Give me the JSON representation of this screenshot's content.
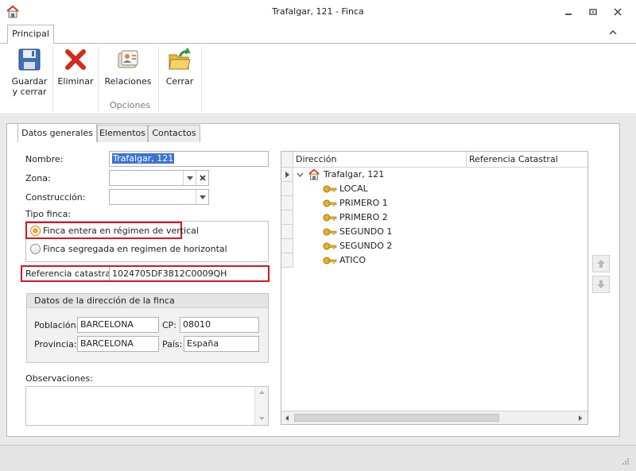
{
  "window": {
    "title": "Trafalgar, 121 - Finca"
  },
  "ribbon": {
    "tab": "Principal",
    "buttons": {
      "guardar": "Guardar\ny cerrar",
      "eliminar": "Eliminar",
      "relaciones": "Relaciones",
      "cerrar": "Cerrar"
    },
    "group_label": "Opciones"
  },
  "tabs": [
    "Datos generales",
    "Elementos",
    "Contactos"
  ],
  "form": {
    "nombre_label": "Nombre:",
    "nombre_value": "Trafalgar, 121",
    "zona_label": "Zona:",
    "zona_value": "",
    "construccion_label": "Construcción:",
    "construccion_value": "",
    "tipo_label": "Tipo finca:",
    "radio_vertical": "Finca entera en régimen de vertical",
    "radio_horizontal": "Finca segregada en regimen de horizontal",
    "radio_selected": "vertical",
    "referencia_label": "Referencia catastral:",
    "referencia_value": "1024705DF3812C0009QH",
    "direccion_group": "Datos de la dirección de la finca",
    "poblacion_label": "Población:",
    "poblacion_value": "BARCELONA",
    "cp_label": "CP:",
    "cp_value": "08010",
    "provincia_label": "Provincia:",
    "provincia_value": "BARCELONA",
    "pais_label": "País:",
    "pais_value": "España",
    "observaciones_label": "Observaciones:",
    "observaciones_value": ""
  },
  "grid": {
    "columns": [
      "Dirección",
      "Referencia Catastral"
    ],
    "root": "Trafalgar, 121",
    "children": [
      "LOCAL",
      "PRIMERO 1",
      "PRIMERO 2",
      "SEGUNDO 1",
      "SEGUNDO 2",
      "ATICO"
    ]
  },
  "colors": {
    "highlight_border": "#d8141c",
    "selection": "#3b73d1",
    "radio_on": "#f0a22c"
  }
}
